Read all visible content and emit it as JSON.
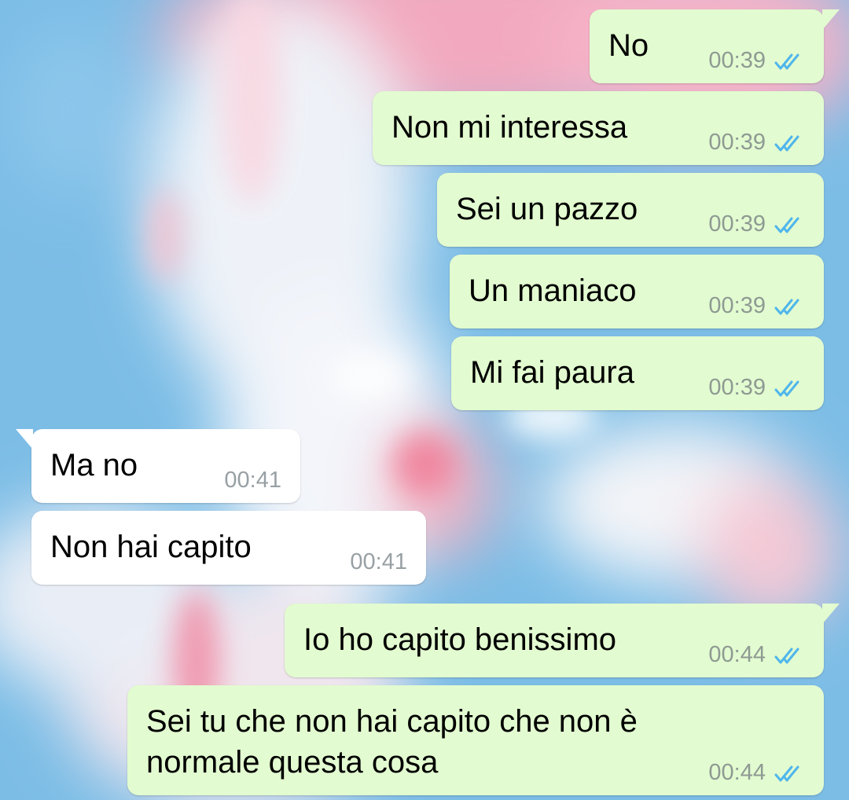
{
  "chat": {
    "messages": [
      {
        "text": "No",
        "time": "00:39",
        "status": "read",
        "direction": "outgoing"
      },
      {
        "text": "Non mi interessa",
        "time": "00:39",
        "status": "read",
        "direction": "outgoing"
      },
      {
        "text": "Sei un pazzo",
        "time": "00:39",
        "status": "read",
        "direction": "outgoing"
      },
      {
        "text": "Un maniaco",
        "time": "00:39",
        "status": "read",
        "direction": "outgoing"
      },
      {
        "text": "Mi fai paura",
        "time": "00:39",
        "status": "read",
        "direction": "outgoing"
      },
      {
        "text": "Ma no",
        "time": "00:41",
        "direction": "incoming"
      },
      {
        "text": "Non hai capito",
        "time": "00:41",
        "direction": "incoming"
      },
      {
        "text": "Io ho capito benissimo",
        "time": "00:44",
        "status": "read",
        "direction": "outgoing"
      },
      {
        "text": "Sei tu che non hai capito che non è normale questa cosa",
        "time": "00:44",
        "status": "read",
        "direction": "outgoing"
      }
    ]
  },
  "colors": {
    "outgoing_bubble": "#e2fbd0",
    "incoming_bubble": "#ffffff",
    "read_ticks": "#4fb6ec",
    "timestamp": "#8e9a93"
  },
  "icons": {
    "read_status": "double-check-icon"
  }
}
